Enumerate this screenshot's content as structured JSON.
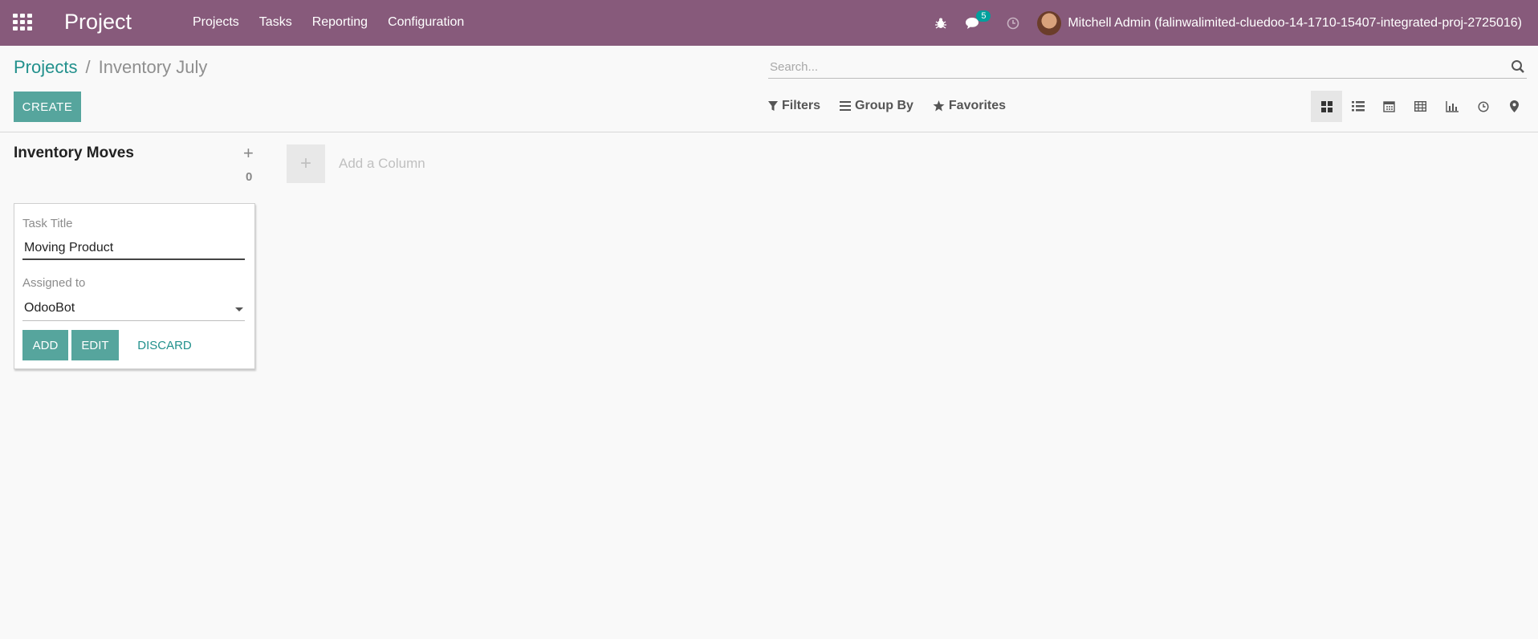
{
  "navbar": {
    "brand": "Project",
    "menu": [
      "Projects",
      "Tasks",
      "Reporting",
      "Configuration"
    ],
    "messages_count": "5",
    "user": "Mitchell Admin (falinwalimited-cluedoo-14-1710-15407-integrated-proj-2725016)"
  },
  "breadcrumb": {
    "parent": "Projects",
    "separator": "/",
    "current": "Inventory July"
  },
  "search": {
    "placeholder": "Search..."
  },
  "toolbar": {
    "create_label": "CREATE"
  },
  "filters": {
    "filters_label": "Filters",
    "group_by_label": "Group By",
    "favorites_label": "Favorites"
  },
  "views": [
    "kanban",
    "list",
    "calendar",
    "pivot",
    "graph",
    "activity",
    "map"
  ],
  "column": {
    "title": "Inventory Moves",
    "count": "0",
    "quick_create": {
      "title_label": "Task Title",
      "title_value": "Moving Product",
      "assigned_label": "Assigned to",
      "assigned_value": "OdooBot",
      "add_label": "ADD",
      "edit_label": "EDIT",
      "discard_label": "DISCARD"
    }
  },
  "add_column": {
    "plus": "+",
    "label": "Add a Column"
  },
  "colors": {
    "navbar": "#875a7b",
    "primary": "#56a59d",
    "link": "#21908c"
  }
}
